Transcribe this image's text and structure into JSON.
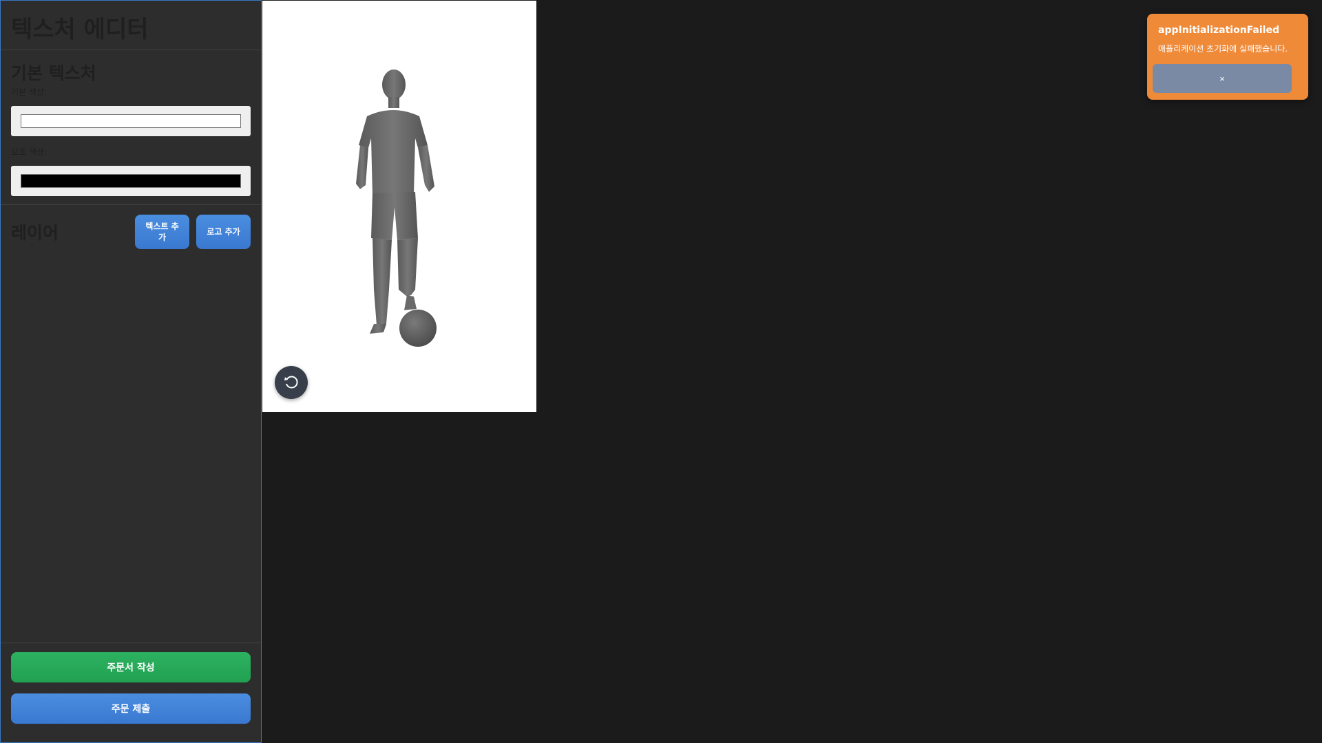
{
  "sidebar": {
    "title": "텍스처 에디터",
    "base_texture": {
      "heading": "기본 텍스처",
      "primary_label": "기본 색상:",
      "primary_color": "#ffffff",
      "secondary_label": "보조 색상:",
      "secondary_color": "#000000"
    },
    "layers": {
      "heading": "레이어",
      "add_text_label": "텍스트 추가",
      "add_logo_label": "로고 추가"
    },
    "create_order_label": "주문서 작성",
    "submit_order_label": "주문 제출"
  },
  "viewer": {
    "reset_icon": "rotate-reset-icon"
  },
  "toast": {
    "title": "appInitializationFailed",
    "message": "애플리케이션 초기화에 실패했습니다.",
    "close_label": "×",
    "color": "#ef8a39"
  },
  "colors": {
    "accent_blue": "#3a78d0",
    "accent_green": "#27a85a",
    "background": "#1b1b1b",
    "sidebar": "#2d2d2d"
  }
}
